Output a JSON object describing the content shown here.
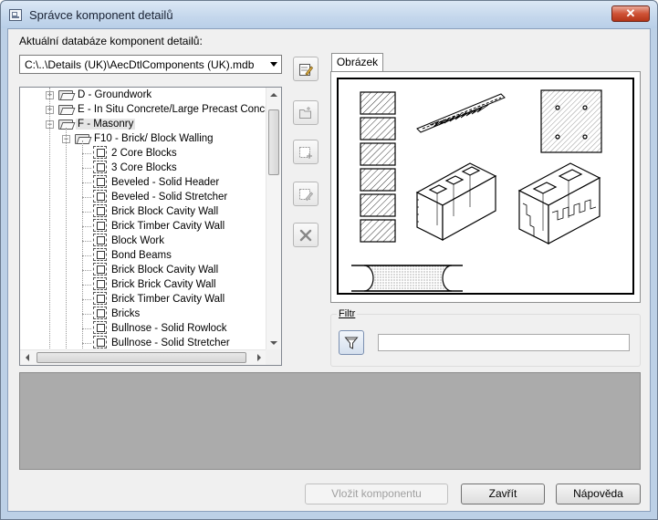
{
  "window": {
    "title": "Správce komponent detailů"
  },
  "database": {
    "label": "Aktuální databáze komponent detailů:",
    "current": "C:\\..\\Details (UK)\\AecDtlComponents (UK).mdb"
  },
  "tree": {
    "items": [
      {
        "label": "D - Groundwork",
        "type": "folder",
        "expander": "+"
      },
      {
        "label": "E - In Situ Concrete/Large Precast Concrete",
        "type": "folder",
        "expander": "+"
      },
      {
        "label": "F - Masonry",
        "type": "folder",
        "expander": "−",
        "selected": true
      },
      {
        "label": "F10 - Brick/ Block Walling",
        "type": "folder",
        "expander": "−"
      },
      {
        "label": "2 Core Blocks",
        "type": "component"
      },
      {
        "label": "3 Core Blocks",
        "type": "component"
      },
      {
        "label": "Beveled - Solid Header",
        "type": "component"
      },
      {
        "label": "Beveled - Solid Stretcher",
        "type": "component"
      },
      {
        "label": "Brick Block Cavity Wall",
        "type": "component"
      },
      {
        "label": "Brick Timber Cavity Wall",
        "type": "component"
      },
      {
        "label": "Block Work",
        "type": "component"
      },
      {
        "label": "Bond Beams",
        "type": "component"
      },
      {
        "label": "Brick Block Cavity Wall",
        "type": "component"
      },
      {
        "label": "Brick Brick Cavity Wall",
        "type": "component"
      },
      {
        "label": "Brick Timber Cavity Wall",
        "type": "component"
      },
      {
        "label": "Bricks",
        "type": "component"
      },
      {
        "label": "Bullnose - Solid Rowlock",
        "type": "component"
      },
      {
        "label": "Bullnose - Solid Stretcher",
        "type": "component"
      }
    ]
  },
  "toolbar": {
    "buttons": [
      "edit-database-icon",
      "open-folder-icon",
      "new-item-icon",
      "edit-item-icon",
      "delete-icon"
    ]
  },
  "preview": {
    "tab_label": "Obrázek"
  },
  "filter": {
    "legend": "Filtr",
    "value": ""
  },
  "buttons": {
    "insert": "Vložit komponentu",
    "close": "Zavřít",
    "help": "Nápověda"
  }
}
